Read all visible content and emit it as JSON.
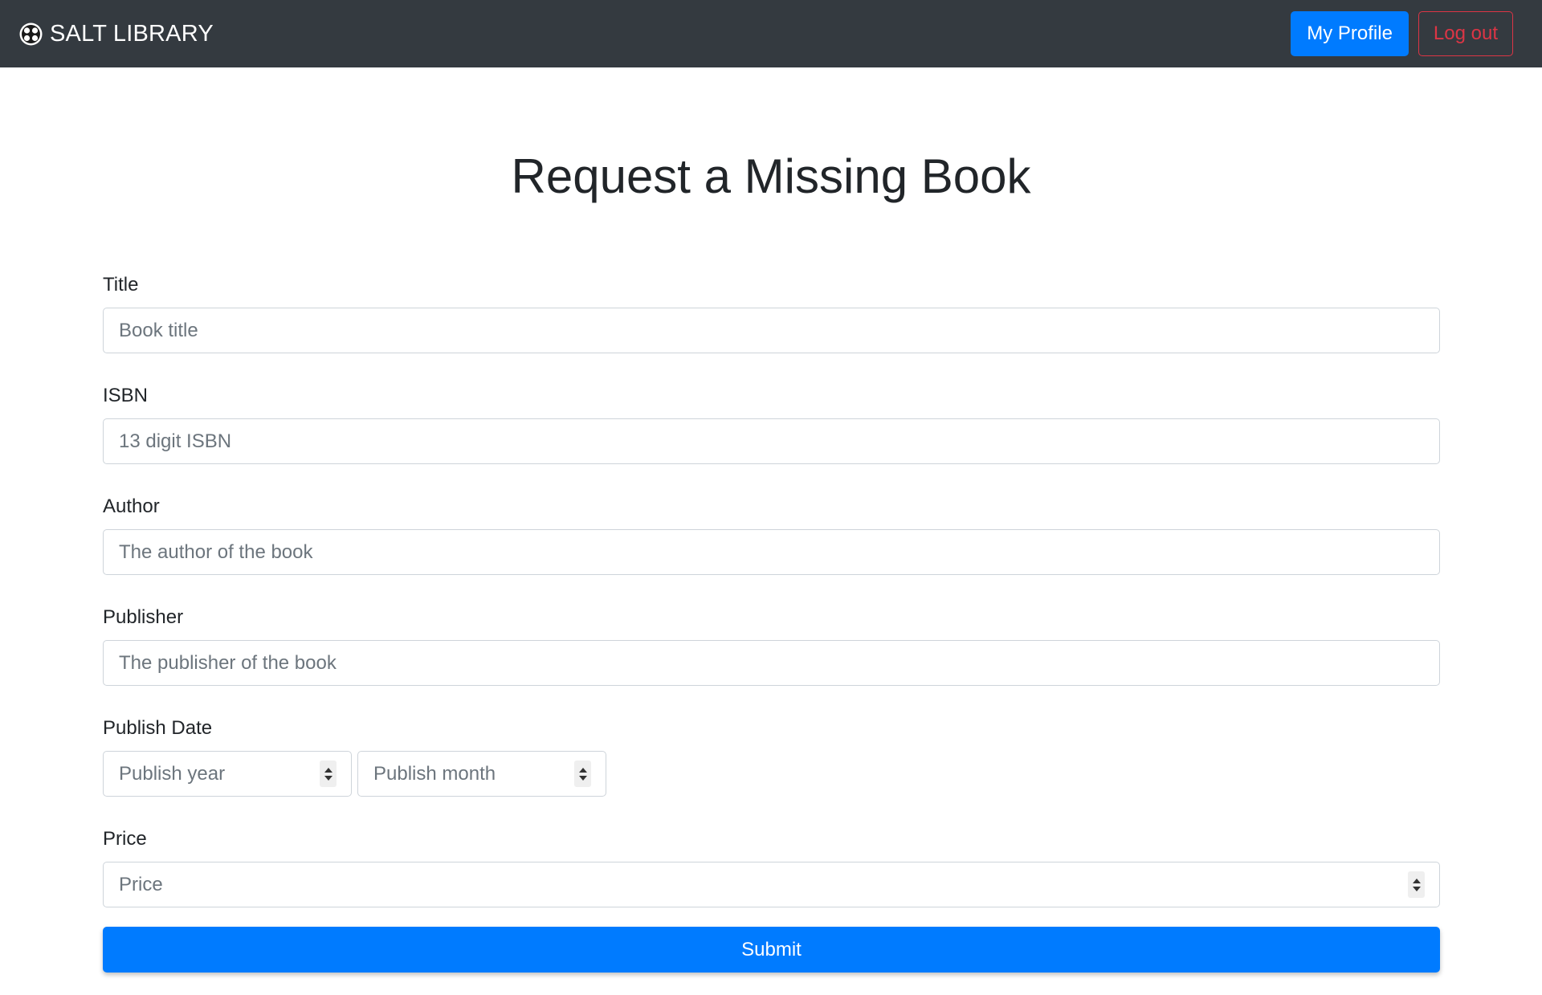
{
  "navbar": {
    "brand": "SALT LIBRARY",
    "logo_icon": "salt-library-logo-icon",
    "profile_label": "My Profile",
    "logout_label": "Log out"
  },
  "page": {
    "title": "Request a Missing Book"
  },
  "form": {
    "title": {
      "label": "Title",
      "placeholder": "Book title",
      "value": ""
    },
    "isbn": {
      "label": "ISBN",
      "placeholder": "13 digit ISBN",
      "value": ""
    },
    "author": {
      "label": "Author",
      "placeholder": "The author of the book",
      "value": ""
    },
    "publisher": {
      "label": "Publisher",
      "placeholder": "The publisher of the book",
      "value": ""
    },
    "publish_date": {
      "label": "Publish Date",
      "year_placeholder": "Publish year",
      "month_placeholder": "Publish month"
    },
    "price": {
      "label": "Price",
      "placeholder": "Price",
      "value": ""
    },
    "submit_label": "Submit"
  },
  "colors": {
    "navbar_bg": "#343a40",
    "primary": "#007bff",
    "danger": "#dc3545",
    "text": "#212529",
    "placeholder": "#6c757d",
    "border": "#ced4da"
  }
}
